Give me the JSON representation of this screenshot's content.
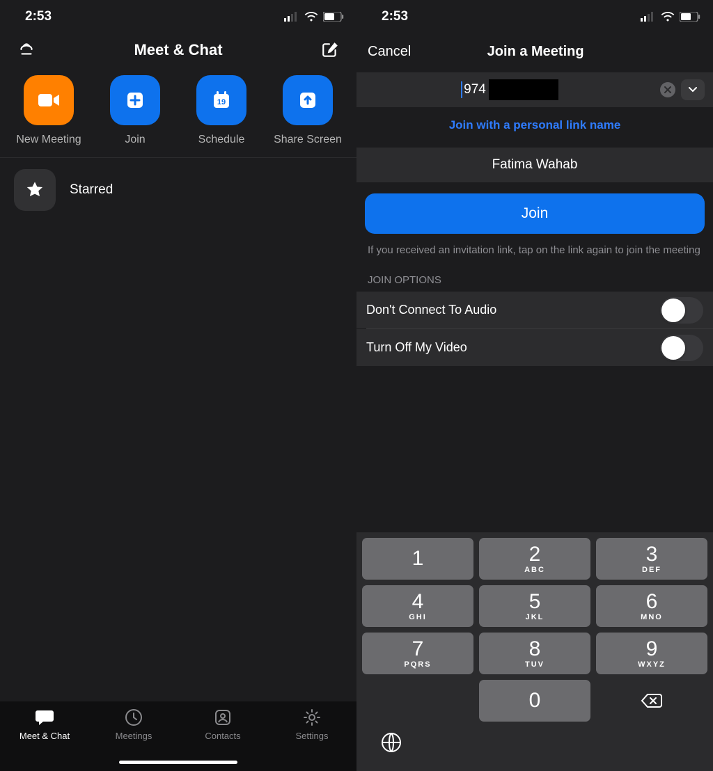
{
  "status": {
    "time": "2:53"
  },
  "left": {
    "header_title": "Meet & Chat",
    "actions": [
      {
        "label": "New Meeting"
      },
      {
        "label": "Join"
      },
      {
        "label": "Schedule"
      },
      {
        "label": "Share Screen"
      }
    ],
    "starred": "Starred",
    "tabs": [
      {
        "label": "Meet & Chat"
      },
      {
        "label": "Meetings"
      },
      {
        "label": "Contacts"
      },
      {
        "label": "Settings"
      }
    ]
  },
  "right": {
    "cancel": "Cancel",
    "title": "Join a Meeting",
    "meeting_id_visible": "974",
    "personal_link": "Join with a personal link name",
    "name_value": "Fatima Wahab",
    "join_label": "Join",
    "help_text": "If you received an invitation link, tap on the link again to join the meeting",
    "join_options_label": "JOIN OPTIONS",
    "toggles": [
      {
        "label": "Don't Connect To Audio",
        "on": false
      },
      {
        "label": "Turn Off My Video",
        "on": false
      }
    ],
    "keypad": [
      {
        "d": "1",
        "l": ""
      },
      {
        "d": "2",
        "l": "ABC"
      },
      {
        "d": "3",
        "l": "DEF"
      },
      {
        "d": "4",
        "l": "GHI"
      },
      {
        "d": "5",
        "l": "JKL"
      },
      {
        "d": "6",
        "l": "MNO"
      },
      {
        "d": "7",
        "l": "PQRS"
      },
      {
        "d": "8",
        "l": "TUV"
      },
      {
        "d": "9",
        "l": "WXYZ"
      }
    ],
    "zero": "0"
  }
}
